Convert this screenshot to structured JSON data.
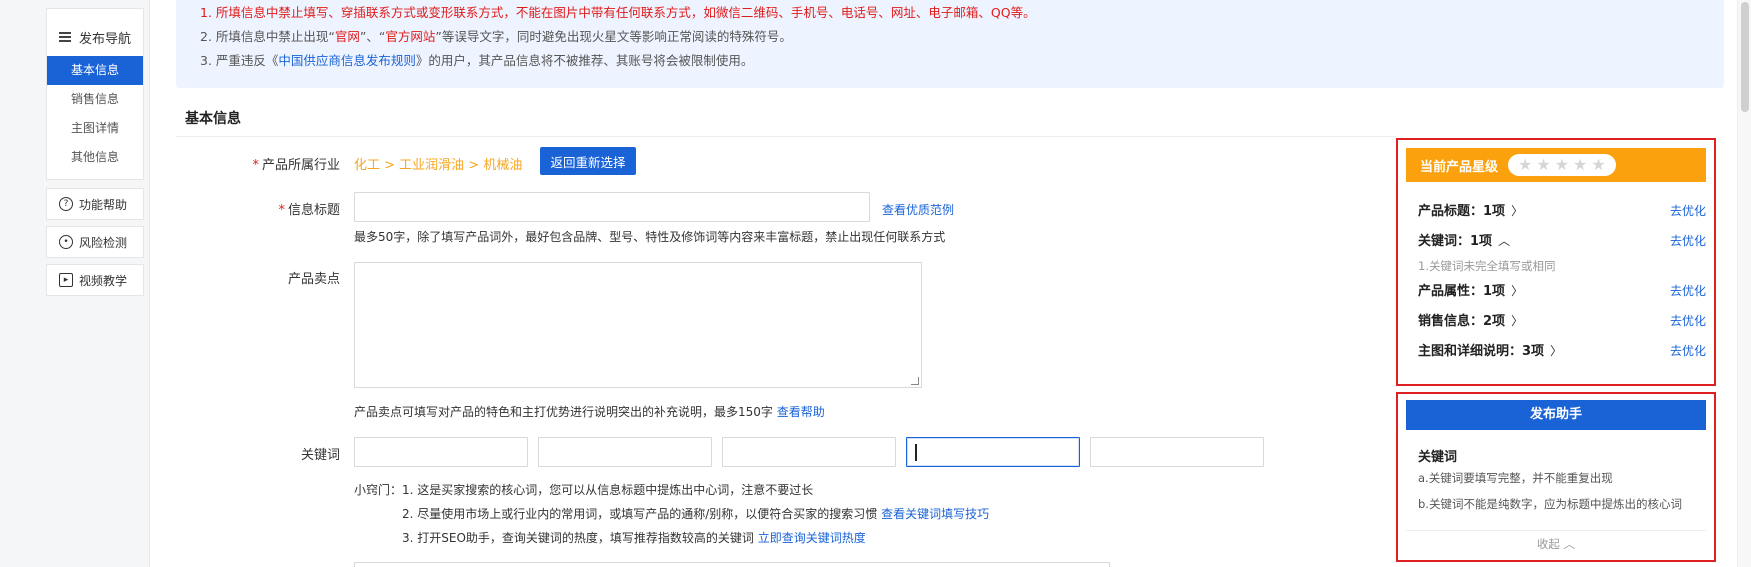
{
  "nav": {
    "title": "发布导航",
    "items": [
      {
        "label": "基本信息",
        "active": true
      },
      {
        "label": "销售信息",
        "active": false
      },
      {
        "label": "主图详情",
        "active": false
      },
      {
        "label": "其他信息",
        "active": false
      }
    ],
    "tools": [
      {
        "label": "功能帮助",
        "icon": "question-icon"
      },
      {
        "label": "风险检测",
        "icon": "target-icon"
      },
      {
        "label": "视频教学",
        "icon": "video-icon"
      }
    ]
  },
  "notice": {
    "line1": "1. 所填信息中禁止填写、穿插联系方式或变形联系方式，不能在图片中带有任何联系方式，如微信二维码、手机号、电话号、网址、电子邮箱、QQ等。",
    "line2_a": "2. 所填信息中禁止出现“",
    "line2_b": "官网",
    "line2_c": "”、“",
    "line2_d": "官方网站",
    "line2_e": "”等误导文字，同时避免出现火星文等影响正常阅读的特殊符号。",
    "line3_a": "3. 严重违反《",
    "line3_b": "中国供应商信息发布规则",
    "line3_c": "》的用户，其产品信息将不被推荐、其账号将会被限制使用。"
  },
  "section_title": "基本信息",
  "form": {
    "industry_label": "产品所属行业",
    "industry_path": "化工 > 工业润滑油 > 机械油",
    "reselect_btn": "返回重新选择",
    "title_label": "信息标题",
    "title_value": "",
    "title_example_link": "查看优质范例",
    "title_hint": "最多50字，除了填写产品词外，最好包含品牌、型号、特性及修饰词等内容来丰富标题，禁止出现任何联系方式",
    "selling_label": "产品卖点",
    "selling_value": "",
    "selling_hint": "产品卖点可填写对产品的特色和主打优势进行说明突出的补充说明，最多150字",
    "selling_help_link": "查看帮助",
    "keyword_label": "关键词",
    "keywords": [
      "",
      "",
      "",
      "",
      ""
    ],
    "tips_prefix": "小窍门：",
    "tip1": "1. 这是买家搜索的核心词，您可以从信息标题中提炼出中心词，注意不要过长",
    "tip2": "2. 尽量使用市场上或行业内的常用词，或填写产品的通称/别称，以便符合买家的搜索习惯",
    "tip2_link": "查看关键词填写技巧",
    "tip3": "3. 打开SEO助手，查询关键词的热度，填写推荐指数较高的关键词",
    "tip3_link": "立即查询关键词热度"
  },
  "star_panel": {
    "title": "当前产品星级",
    "stars_total": 5,
    "stars_filled": 0,
    "rows": [
      {
        "label": "产品标题：",
        "count": "1项",
        "chev": "〉",
        "action": "去优化"
      },
      {
        "label": "关键词：",
        "count": "1项",
        "chev": "︿",
        "action": "去优化"
      },
      {
        "label": "产品属性：",
        "count": "1项",
        "chev": "〉",
        "action": "去优化"
      },
      {
        "label": "销售信息：",
        "count": "2项",
        "chev": "〉",
        "action": "去优化"
      },
      {
        "label": "主图和详细说明：",
        "count": "3项",
        "chev": "〉",
        "action": "去优化"
      }
    ],
    "keyword_note": "1.关键词未完全填写或相同"
  },
  "helper_panel": {
    "title": "发布助手",
    "section": "关键词",
    "line_a": "a.关键词要填写完整，并不能重复出现",
    "line_b": "b.关键词不能是纯数字，应为标题中提炼出的核心词",
    "collapse": "收起 ︿"
  },
  "colors": {
    "accent": "#1a63d6",
    "warning": "#e01b1b",
    "orange": "#fba10d"
  }
}
